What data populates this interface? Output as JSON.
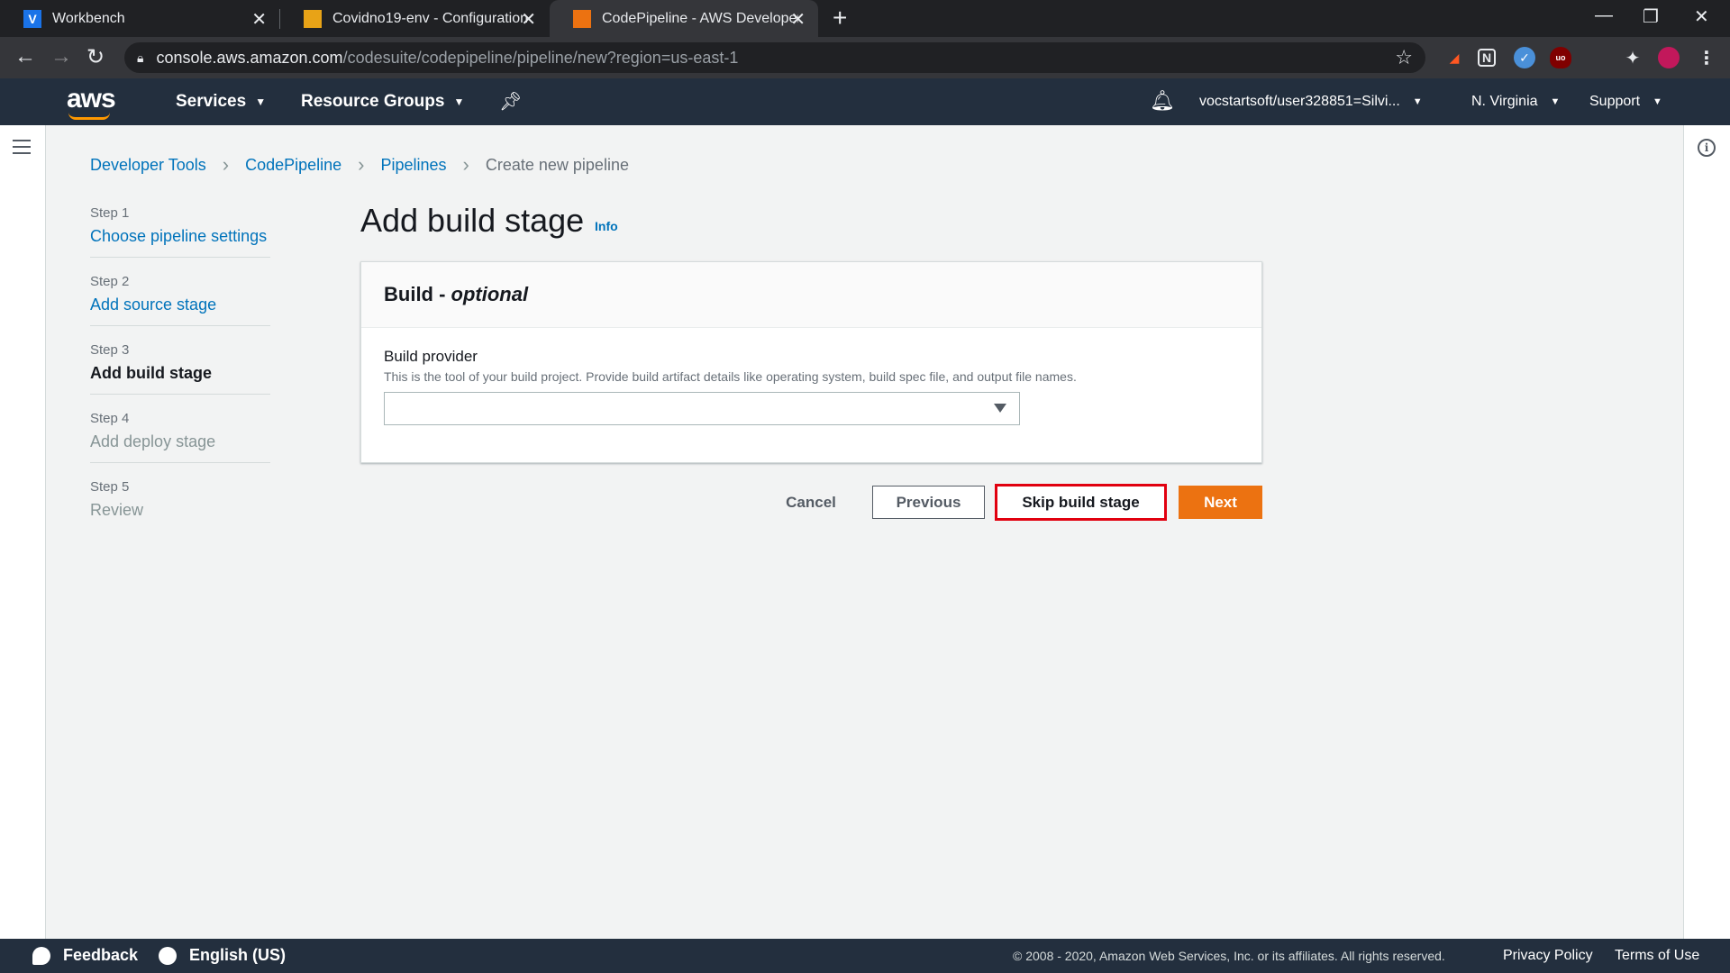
{
  "browser": {
    "tabs": [
      {
        "title": "Workbench",
        "favicon": "V",
        "favicon_color": "#1a73e8"
      },
      {
        "title": "Covidno19-env - Configuration",
        "favicon": "",
        "favicon_color": "#e8a317"
      },
      {
        "title": "CodePipeline - AWS Developer To",
        "favicon": "",
        "favicon_color": "#ec7211"
      }
    ],
    "url_host": "console.aws.amazon.com",
    "url_path": "/codesuite/codepipeline/pipeline/new?region=us-east-1"
  },
  "aws_nav": {
    "logo": "aws",
    "services_label": "Services",
    "resource_groups_label": "Resource Groups",
    "account_label": "vocstartsoft/user328851=Silvi...",
    "region_label": "N. Virginia",
    "support_label": "Support"
  },
  "breadcrumb": [
    {
      "label": "Developer Tools"
    },
    {
      "label": "CodePipeline"
    },
    {
      "label": "Pipelines"
    },
    {
      "label": "Create new pipeline"
    }
  ],
  "steps": [
    {
      "num": "Step 1",
      "label": "Choose pipeline settings"
    },
    {
      "num": "Step 2",
      "label": "Add source stage"
    },
    {
      "num": "Step 3",
      "label": "Add build stage"
    },
    {
      "num": "Step 4",
      "label": "Add deploy stage"
    },
    {
      "num": "Step 5",
      "label": "Review"
    }
  ],
  "page": {
    "title": "Add build stage",
    "info_link": "Info"
  },
  "panel": {
    "header_main": "Build - ",
    "header_optional": "optional",
    "field_label": "Build provider",
    "field_description": "This is the tool of your build project. Provide build artifact details like operating system, build spec file, and output file names.",
    "select_value": ""
  },
  "actions": {
    "cancel": "Cancel",
    "previous": "Previous",
    "skip": "Skip build stage",
    "next": "Next"
  },
  "footer": {
    "feedback": "Feedback",
    "language": "English (US)",
    "copyright": "© 2008 - 2020, Amazon Web Services, Inc. or its affiliates. All rights reserved.",
    "privacy": "Privacy Policy",
    "terms": "Terms of Use"
  },
  "colors": {
    "aws_nav": "#232f3e",
    "link": "#0073bb",
    "primary_button": "#ec7211",
    "highlight": "#e1000f"
  }
}
